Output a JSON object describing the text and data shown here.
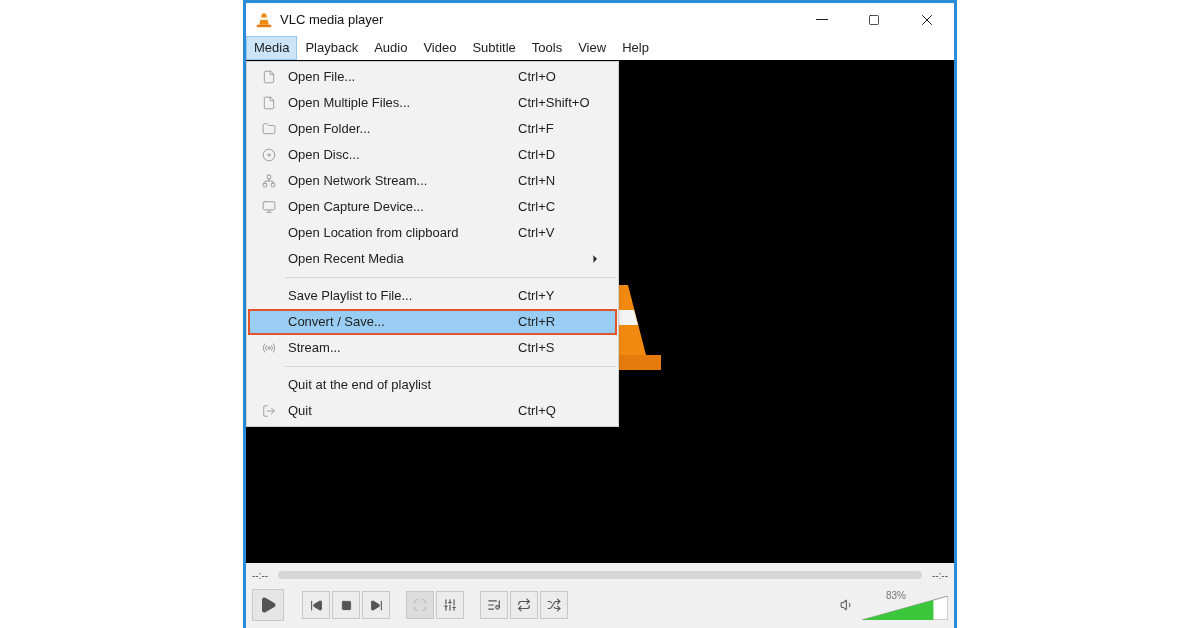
{
  "window": {
    "title": "VLC media player"
  },
  "menubar": [
    {
      "label": "Media",
      "selected": true
    },
    {
      "label": "Playback",
      "selected": false
    },
    {
      "label": "Audio",
      "selected": false
    },
    {
      "label": "Video",
      "selected": false
    },
    {
      "label": "Subtitle",
      "selected": false
    },
    {
      "label": "Tools",
      "selected": false
    },
    {
      "label": "View",
      "selected": false
    },
    {
      "label": "Help",
      "selected": false
    }
  ],
  "media_menu": [
    {
      "kind": "item",
      "label": "Open File...",
      "shortcut": "Ctrl+O",
      "selected": false
    },
    {
      "kind": "item",
      "label": "Open Multiple Files...",
      "shortcut": "Ctrl+Shift+O",
      "selected": false
    },
    {
      "kind": "item",
      "label": "Open Folder...",
      "shortcut": "Ctrl+F",
      "selected": false
    },
    {
      "kind": "item",
      "label": "Open Disc...",
      "shortcut": "Ctrl+D",
      "selected": false
    },
    {
      "kind": "item",
      "label": "Open Network Stream...",
      "shortcut": "Ctrl+N",
      "selected": false
    },
    {
      "kind": "item",
      "label": "Open Capture Device...",
      "shortcut": "Ctrl+C",
      "selected": false
    },
    {
      "kind": "item",
      "label": "Open Location from clipboard",
      "shortcut": "Ctrl+V",
      "selected": false
    },
    {
      "kind": "item",
      "label": "Open Recent Media",
      "submenu": true,
      "selected": false
    },
    {
      "kind": "separator"
    },
    {
      "kind": "item",
      "label": "Save Playlist to File...",
      "shortcut": "Ctrl+Y",
      "selected": false
    },
    {
      "kind": "item",
      "label": "Convert / Save...",
      "shortcut": "Ctrl+R",
      "selected": true
    },
    {
      "kind": "item",
      "label": "Stream...",
      "shortcut": "Ctrl+S",
      "selected": false
    },
    {
      "kind": "separator"
    },
    {
      "kind": "item",
      "label": "Quit at the end of playlist",
      "selected": false
    },
    {
      "kind": "item",
      "label": "Quit",
      "shortcut": "Ctrl+Q",
      "selected": false
    }
  ],
  "controls": {
    "elapsed": "--:--",
    "remaining": "--:--",
    "fullscreen_disabled": true,
    "volume": {
      "reading": "83%",
      "level": 0.83
    }
  }
}
